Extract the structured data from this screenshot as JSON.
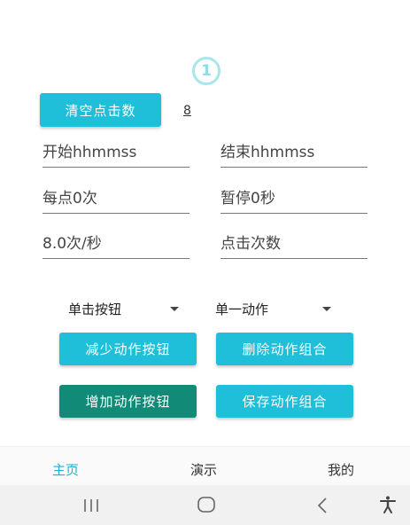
{
  "step_indicator": "1",
  "buttons": {
    "clear_clicks": "清空点击数",
    "reduce_action": "减少动作按钮",
    "delete_combo": "删除动作组合",
    "add_action": "增加动作按钮",
    "save_combo": "保存动作组合"
  },
  "click_count": "8",
  "fields": {
    "start_time": "开始hhmmss",
    "end_time": "结束hhmmss",
    "per_point": "每点0次",
    "pause": "暂停0秒",
    "rate": "8.0次/秒",
    "click_times": "点击次数"
  },
  "spinners": {
    "click_type": "单击按钮",
    "action_mode": "单一动作"
  },
  "bottom_nav": {
    "home": "主页",
    "demo": "演示",
    "mine": "我的"
  },
  "colors": {
    "accent": "#1fbfd9",
    "accent_dark": "#128a78",
    "nav_active": "#1fb3cf"
  },
  "icons": {
    "recents": "recents-icon",
    "home": "home-icon",
    "back": "back-icon",
    "accessibility": "accessibility-icon"
  }
}
